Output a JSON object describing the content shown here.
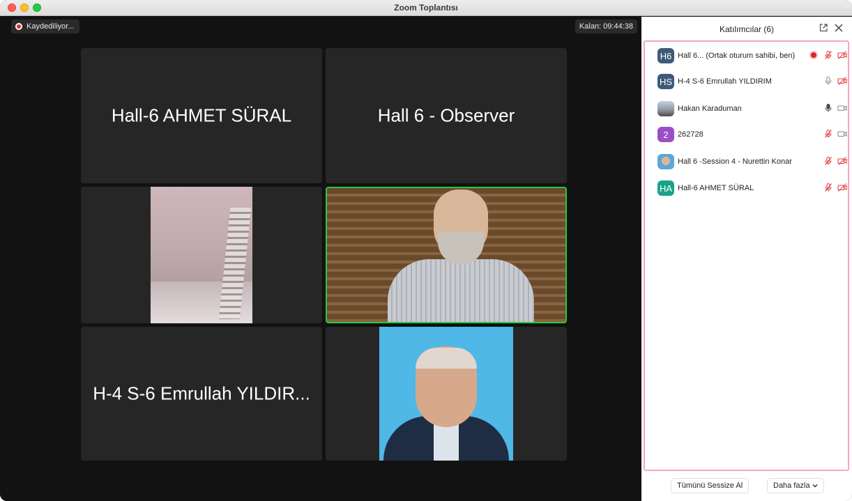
{
  "window": {
    "title": "Zoom Toplantısı"
  },
  "meeting": {
    "recording_label": "Kaydediliyor...",
    "timer": "Kalan: 09:44:38",
    "tiles": [
      {
        "name": "Hall-6 AHMET SÜRAL",
        "type": "name"
      },
      {
        "name": "Hall 6 - Observer",
        "type": "name"
      },
      {
        "type": "video"
      },
      {
        "type": "video",
        "active_speaker": true
      },
      {
        "name": "H-4  S-6 Emrullah YILDIR...",
        "type": "name"
      },
      {
        "type": "video"
      }
    ]
  },
  "participants_panel": {
    "title": "Katılımcılar (6)",
    "participants": [
      {
        "initials": "H6",
        "avatar_color": "#3f5a78",
        "name": "Hall 6...  (Ortak oturum sahibi, ben)",
        "recording": true,
        "mic": "muted",
        "video": "off"
      },
      {
        "initials": "HS",
        "avatar_color": "#3f5a78",
        "name": "H-4  S-6 Emrullah YILDIRIM",
        "mic": "on",
        "video": "off"
      },
      {
        "initials": "",
        "avatar": "photo",
        "name": "Hakan Karaduman",
        "mic": "on-active",
        "video": "on"
      },
      {
        "initials": "2",
        "avatar_color": "#9b4fc7",
        "name": "262728",
        "mic": "muted",
        "video": "on"
      },
      {
        "initials": "",
        "avatar": "photo",
        "name": "Hall 6 -Session 4 - Nurettin Konar",
        "mic": "muted",
        "video": "off"
      },
      {
        "initials": "HA",
        "avatar_color": "#1aa38a",
        "name": "Hall-6 AHMET SÜRAL",
        "mic": "muted",
        "video": "off"
      }
    ],
    "mute_all_label": "Tümünü Sessize Al",
    "more_label": "Daha fazla",
    "status_colors": {
      "muted": "#e23c3c",
      "neutral": "#8a8a8a",
      "active": "#4a4a4a"
    }
  }
}
